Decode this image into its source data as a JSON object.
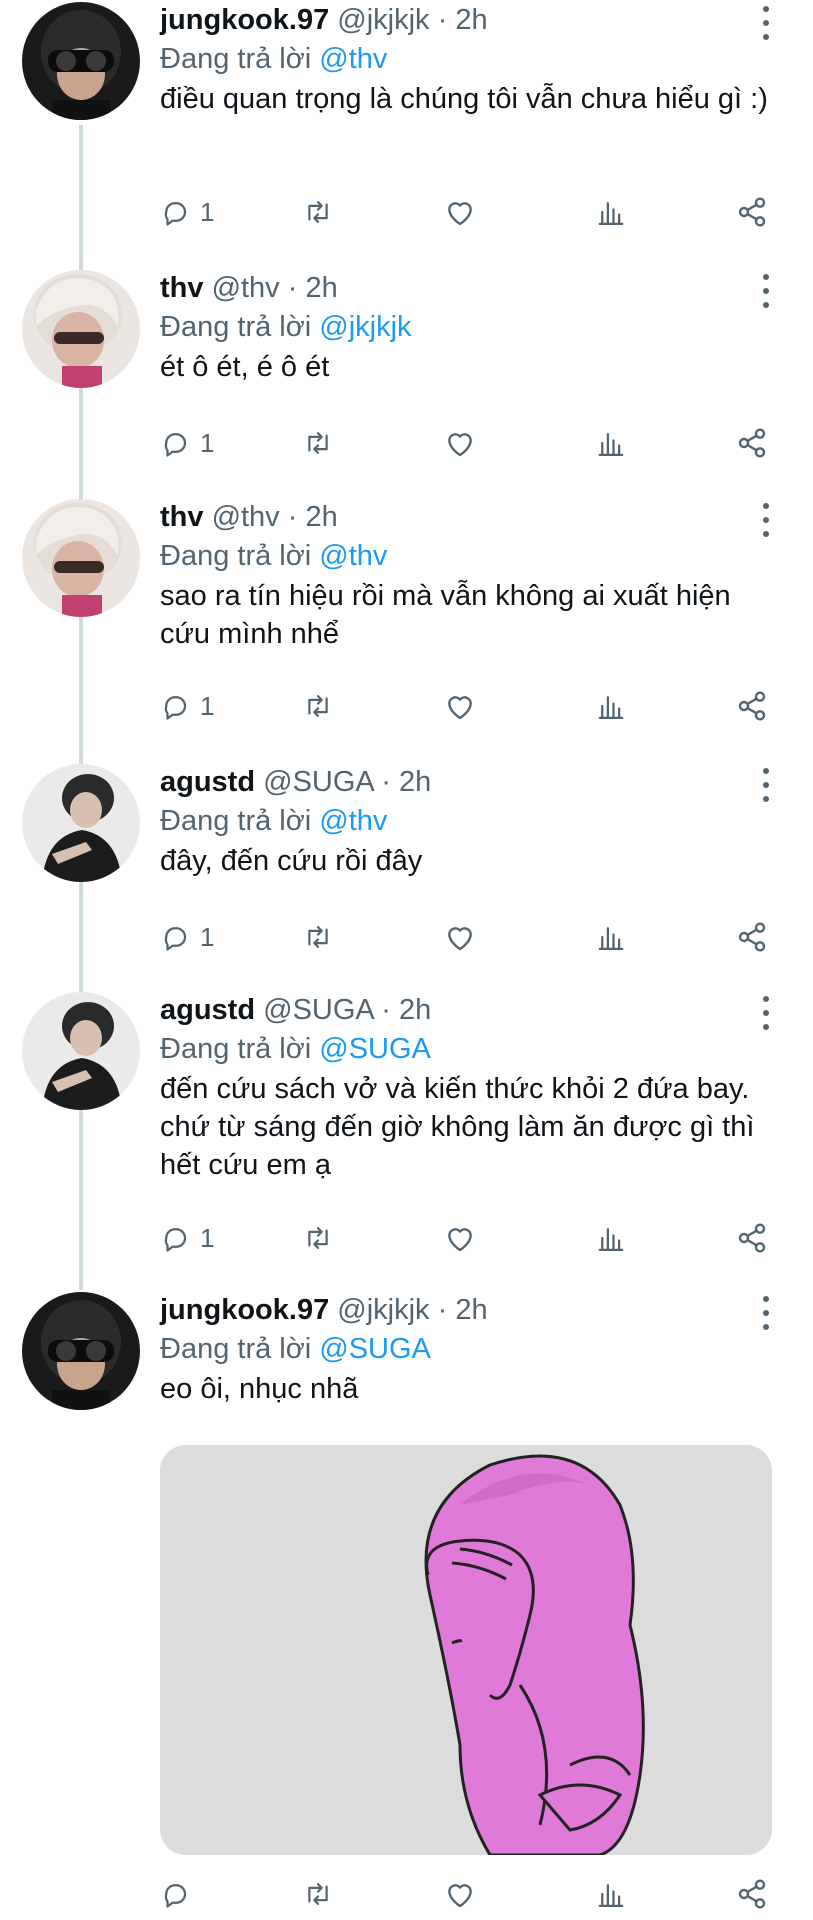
{
  "reply_prefix": "Đang trả lời",
  "tweets": [
    {
      "name": "jungkook.97",
      "handle": "@jkjkjk",
      "separator": "·",
      "time": "2h",
      "reply_to": "@thv",
      "text": "điều quan trọng là chúng tôi vẫn chưa hiểu gì :)",
      "reply_count": "1",
      "avatar": "dark-goggles-avatar"
    },
    {
      "name": "thv",
      "handle": "@thv",
      "separator": "·",
      "time": "2h",
      "reply_to": "@jkjkjk",
      "text": "ét ô ét, é ô ét",
      "reply_count": "1",
      "avatar": "blonde-sunglasses-avatar"
    },
    {
      "name": "thv",
      "handle": "@thv",
      "separator": "·",
      "time": "2h",
      "reply_to": "@thv",
      "text": "sao ra tín hiệu rồi mà vẫn không ai xuất hiện cứu mình nhể",
      "reply_count": "1",
      "avatar": "blonde-sunglasses-avatar"
    },
    {
      "name": "agustd",
      "handle": "@SUGA",
      "separator": "·",
      "time": "2h",
      "reply_to": "@thv",
      "text": "đây, đến cứu rồi đây",
      "reply_count": "1",
      "avatar": "black-shirt-avatar"
    },
    {
      "name": "agustd",
      "handle": "@SUGA",
      "separator": "·",
      "time": "2h",
      "reply_to": "@SUGA",
      "text": "đến cứu sách vở và kiến thức khỏi 2 đứa bay. chứ từ sáng đến giờ không làm ăn được gì thì hết cứu em ạ",
      "reply_count": "1",
      "avatar": "black-shirt-avatar"
    },
    {
      "name": "jungkook.97",
      "handle": "@jkjkjk",
      "separator": "·",
      "time": "2h",
      "reply_to": "@SUGA",
      "text": "eo ôi, nhục nhã",
      "reply_count": "",
      "avatar": "dark-goggles-avatar",
      "media": "pink-facepalm-meme-image"
    }
  ],
  "icons": {
    "reply": "reply-icon",
    "retweet": "retweet-icon",
    "like": "like-icon",
    "analytics": "analytics-icon",
    "share": "share-icon",
    "more": "more-options-icon"
  },
  "colors": {
    "text": "#0f1419",
    "secondary": "#536471",
    "mention": "#1d9bf0",
    "thread_line": "#cfd9de",
    "meme_pink": "#e07ad8"
  }
}
